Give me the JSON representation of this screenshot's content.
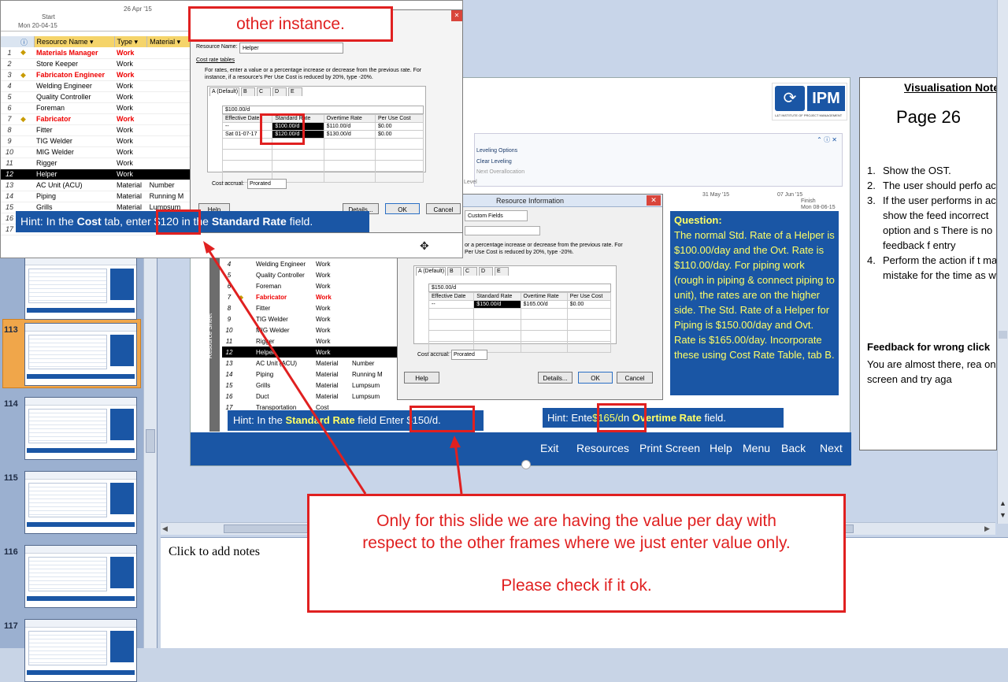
{
  "popup": {
    "gantt_date_a": "26 Apr '15",
    "start_label": "Start",
    "start_date": "Mon 20-04-15",
    "columns": [
      "Resource Name",
      "Type",
      "Material"
    ],
    "rows": [
      {
        "n": "1",
        "warn": true,
        "name": "Materials Manager",
        "type": "Work",
        "mat": "",
        "red": true
      },
      {
        "n": "2",
        "warn": false,
        "name": "Store Keeper",
        "type": "Work",
        "mat": "",
        "red": false
      },
      {
        "n": "3",
        "warn": true,
        "name": "Fabricaton Engineer",
        "type": "Work",
        "mat": "",
        "red": true
      },
      {
        "n": "4",
        "warn": false,
        "name": "Welding Engineer",
        "type": "Work",
        "mat": "",
        "red": false
      },
      {
        "n": "5",
        "warn": false,
        "name": "Quality Controller",
        "type": "Work",
        "mat": "",
        "red": false
      },
      {
        "n": "6",
        "warn": false,
        "name": "Foreman",
        "type": "Work",
        "mat": "",
        "red": false
      },
      {
        "n": "7",
        "warn": true,
        "name": "Fabricator",
        "type": "Work",
        "mat": "",
        "red": true
      },
      {
        "n": "8",
        "warn": false,
        "name": "Fitter",
        "type": "Work",
        "mat": "",
        "red": false
      },
      {
        "n": "9",
        "warn": false,
        "name": "TIG Welder",
        "type": "Work",
        "mat": "",
        "red": false
      },
      {
        "n": "10",
        "warn": false,
        "name": "MIG Welder",
        "type": "Work",
        "mat": "",
        "red": false
      },
      {
        "n": "11",
        "warn": false,
        "name": "Rigger",
        "type": "Work",
        "mat": "",
        "red": false
      },
      {
        "n": "12",
        "warn": false,
        "name": "Helper",
        "type": "Work",
        "mat": "",
        "red": false,
        "selected": true
      },
      {
        "n": "13",
        "warn": false,
        "name": "AC Unit (ACU)",
        "type": "Material",
        "mat": "Number",
        "red": false
      },
      {
        "n": "14",
        "warn": false,
        "name": "Piping",
        "type": "Material",
        "mat": "Running M",
        "red": false
      },
      {
        "n": "15",
        "warn": false,
        "name": "Grills",
        "type": "Material",
        "mat": "Lumpsum",
        "red": false
      },
      {
        "n": "16",
        "warn": false,
        "name": "",
        "type": "",
        "mat": "",
        "red": false
      },
      {
        "n": "17",
        "warn": false,
        "name": "",
        "type": "",
        "mat": "",
        "red": false
      }
    ],
    "dialog": {
      "resource_name_label": "Resource Name:",
      "resource_name_value": "Helper",
      "cost_rate_tables": "Cost rate tables",
      "instructions": "For rates, enter a value or a percentage increase or decrease from the previous rate. For instance, if a resource's Per Use Cost is reduced by 20%, type -20%.",
      "tabs": [
        "A (Default)",
        "B",
        "C",
        "D",
        "E"
      ],
      "edit_value": "$100.00/d",
      "headers": [
        "Effective Date",
        "Standard Rate",
        "Overtime Rate",
        "Per Use Cost"
      ],
      "rows": [
        [
          "--",
          "$100.00/d",
          "$110.00/d",
          "$0.00"
        ],
        [
          "Sat 01-07-17",
          "$120.00/d",
          "$130.00/d",
          "$0.00"
        ]
      ],
      "cost_accrual_label": "Cost accrual:",
      "cost_accrual_value": "Prorated",
      "help": "Help",
      "details": "Details...",
      "ok": "OK",
      "cancel": "Cancel"
    },
    "hint": {
      "a": "Hint: In the ",
      "b": "Cost",
      "c": " tab, enter ",
      "d": "$120",
      "e": " in the ",
      "f": "Standard Rate",
      "g": " field."
    }
  },
  "callout_top": "other instance.",
  "thumbnails": [
    "113",
    "114",
    "115",
    "116",
    "117"
  ],
  "slide": {
    "logo_text": "IPM",
    "logo_sub": "L&T INSTITUTE OF PROJECT MANAGEMENT",
    "ribbon": [
      "Leveling Options",
      "Clear Leveling",
      "Next Overallocation"
    ],
    "ribbon_group": "Level",
    "gantt_dates": [
      "31 May '15",
      "07 Jun '15"
    ],
    "finish_label": "Finish",
    "finish_date": "Mon 08-06-15",
    "side_label": "Resource Sheet",
    "rows": [
      {
        "n": "4",
        "warn": false,
        "name": "Welding Engineer",
        "type": "Work",
        "mat": "",
        "red": false
      },
      {
        "n": "5",
        "warn": false,
        "name": "Quality Controller",
        "type": "Work",
        "mat": "",
        "red": false
      },
      {
        "n": "6",
        "warn": false,
        "name": "Foreman",
        "type": "Work",
        "mat": "",
        "red": false
      },
      {
        "n": "7",
        "warn": true,
        "name": "Fabricator",
        "type": "Work",
        "mat": "",
        "red": true
      },
      {
        "n": "8",
        "warn": false,
        "name": "Fitter",
        "type": "Work",
        "mat": "",
        "red": false
      },
      {
        "n": "9",
        "warn": false,
        "name": "TIG Welder",
        "type": "Work",
        "mat": "",
        "red": false
      },
      {
        "n": "10",
        "warn": false,
        "name": "MIG Welder",
        "type": "Work",
        "mat": "",
        "red": false
      },
      {
        "n": "11",
        "warn": false,
        "name": "Rigger",
        "type": "Work",
        "mat": "",
        "red": false
      },
      {
        "n": "12",
        "warn": false,
        "name": "Helper",
        "type": "Work",
        "mat": "",
        "red": false,
        "selected": true
      },
      {
        "n": "13",
        "warn": false,
        "name": "AC Unit (ACU)",
        "type": "Material",
        "mat": "Number",
        "red": false
      },
      {
        "n": "14",
        "warn": false,
        "name": "Piping",
        "type": "Material",
        "mat": "Running M",
        "red": false
      },
      {
        "n": "15",
        "warn": false,
        "name": "Grills",
        "type": "Material",
        "mat": "Lumpsum",
        "red": false
      },
      {
        "n": "16",
        "warn": false,
        "name": "Duct",
        "type": "Material",
        "mat": "Lumpsum",
        "red": false
      },
      {
        "n": "17",
        "warn": false,
        "name": "Transportation",
        "type": "Cost",
        "mat": "",
        "red": false
      }
    ],
    "dialog": {
      "title": "Resource Information",
      "tab": "Custom Fields",
      "instructions_a": "or a percentage increase or decrease from the previous rate. For",
      "instructions_b": "Per Use Cost is reduced by 20%, type -20%.",
      "tabs": [
        "A (Default)",
        "B",
        "C",
        "D",
        "E"
      ],
      "edit_value": "$150.00/d",
      "headers": [
        "Effective Date",
        "Standard Rate",
        "Overtime Rate",
        "Per Use Cost"
      ],
      "rows": [
        [
          "--",
          "$150.00/d",
          "$165.00/d",
          "$0.00"
        ]
      ],
      "cost_accrual_label": "Cost accrual:",
      "cost_accrual_value": "Prorated",
      "help": "Help",
      "details": "Details...",
      "ok": "OK",
      "cancel": "Cancel"
    },
    "question_title": "Question:",
    "question_body": "The normal Std. Rate of a Helper is $100.00/day and the Ovt. Rate is $110.00/day. For piping work (rough in piping & connect piping to unit), the rates are on the higher side. The Std. Rate of a  Helper for Piping is $150.00/day and Ovt. Rate is $165.00/day. Incorporate these using Cost Rate Table, tab B.",
    "hint1": {
      "a": "Hint: In the ",
      "b": "Standard Rate",
      "c": " field Enter ",
      "d": "$150/d."
    },
    "hint2": {
      "a": "Hint: Ente",
      "b": "$165/d",
      "c": "n ",
      "d": "Overtime Rate",
      "e": " field."
    },
    "nav": [
      "Exit",
      "Resources",
      "Print Screen",
      "Help",
      "Menu",
      "Back",
      "Next"
    ]
  },
  "visual_notes": {
    "title": "Visualisation Note",
    "page": "Page 26",
    "items": [
      {
        "n": "1.",
        "t": "Show the OST."
      },
      {
        "n": "2.",
        "t": " The user should perfo action."
      },
      {
        "n": "3.",
        "t": "If the user performs in action, show the feed incorrect option and s There is no feedback f entry"
      },
      {
        "n": "4.",
        "t": "Perform the action if t makes mistake for the time as well."
      }
    ],
    "feedback_title": "Feedback for wrong click",
    "feedback_body": "You are almost there, rea on the screen and try aga"
  },
  "big_callout": {
    "line1": "Only for this slide we are having the value per day with",
    "line2": "respect to the other frames where we just enter value only.",
    "line3": "Please check if it ok."
  },
  "notes_placeholder": "Click to add notes",
  "colors": {
    "accent_blue": "#1a56a5",
    "callout_red": "#e02020",
    "question_yellow": "#ffff66"
  }
}
